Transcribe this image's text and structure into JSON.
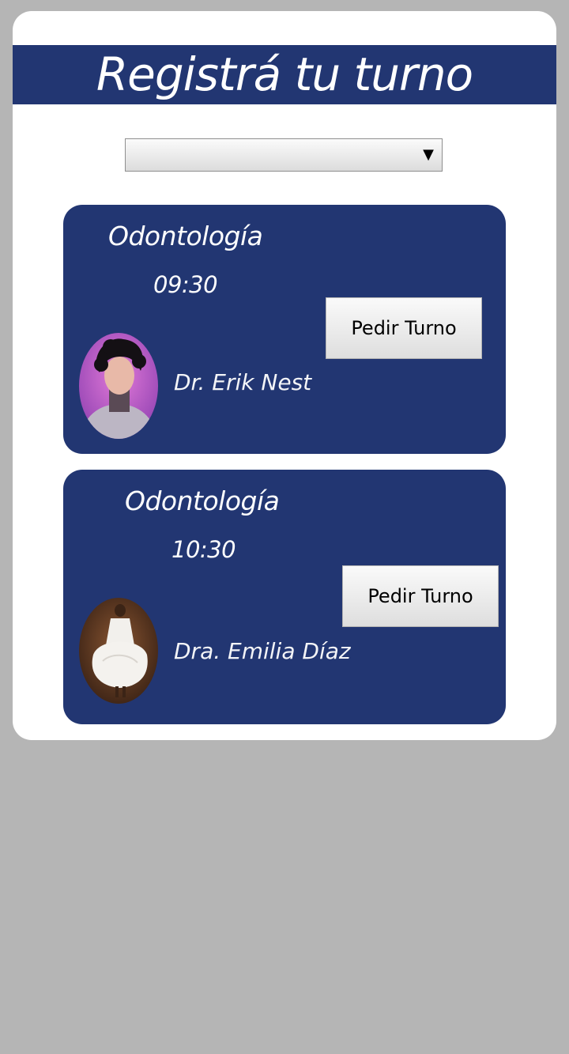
{
  "header": {
    "title": "Registrá tu turno"
  },
  "select": {
    "value": "",
    "arrow": "▼"
  },
  "appointments": [
    {
      "specialty": "Odontología",
      "time": "09:30",
      "doctor": "Dr. Erik Nest",
      "button_label": "Pedir Turno",
      "avatar_icon": "doctor-avatar"
    },
    {
      "specialty": "Odontología",
      "time": "10:30",
      "doctor": "Dra. Emilia Díaz",
      "button_label": "Pedir Turno",
      "avatar_icon": "doctor-avatar"
    }
  ],
  "colors": {
    "brand": "#223672",
    "background": "#b5b5b5",
    "card": "#ffffff"
  }
}
